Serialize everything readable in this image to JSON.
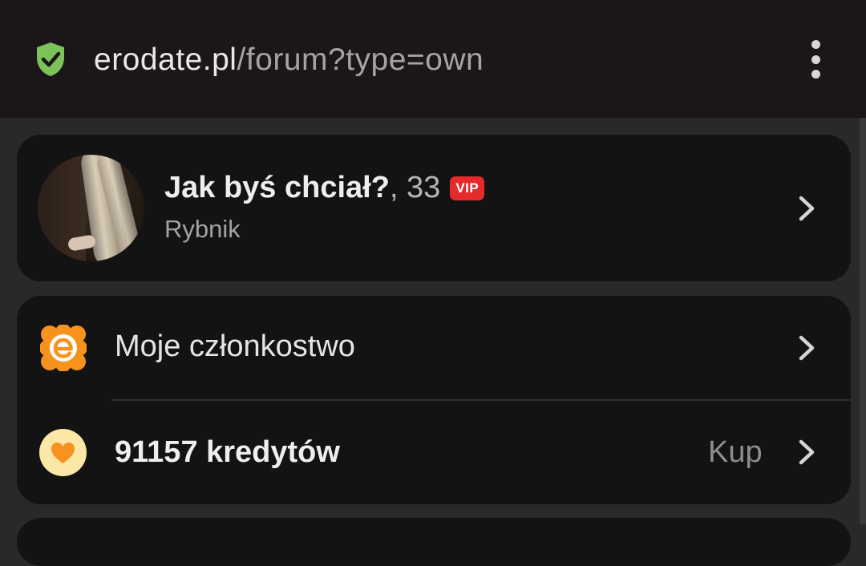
{
  "browser": {
    "url_domain": "erodate.pl",
    "url_path": "/forum?type=own",
    "security_icon": "shield-check-icon",
    "menu_icon": "more-vertical-icon",
    "shield_color": "#7bc25a"
  },
  "profile": {
    "name": "Jak byś chciał?",
    "age_sep": ", 33",
    "badge": "VIP",
    "city": "Rybnik",
    "badge_color": "#e52a2c"
  },
  "menu": {
    "membership_label": "Moje członkostwo",
    "membership_icon": "e-logo-icon",
    "credits_label": "91157 kredytów",
    "credits_icon": "heart-icon",
    "buy_label": "Kup",
    "accent_color": "#f7921e"
  }
}
